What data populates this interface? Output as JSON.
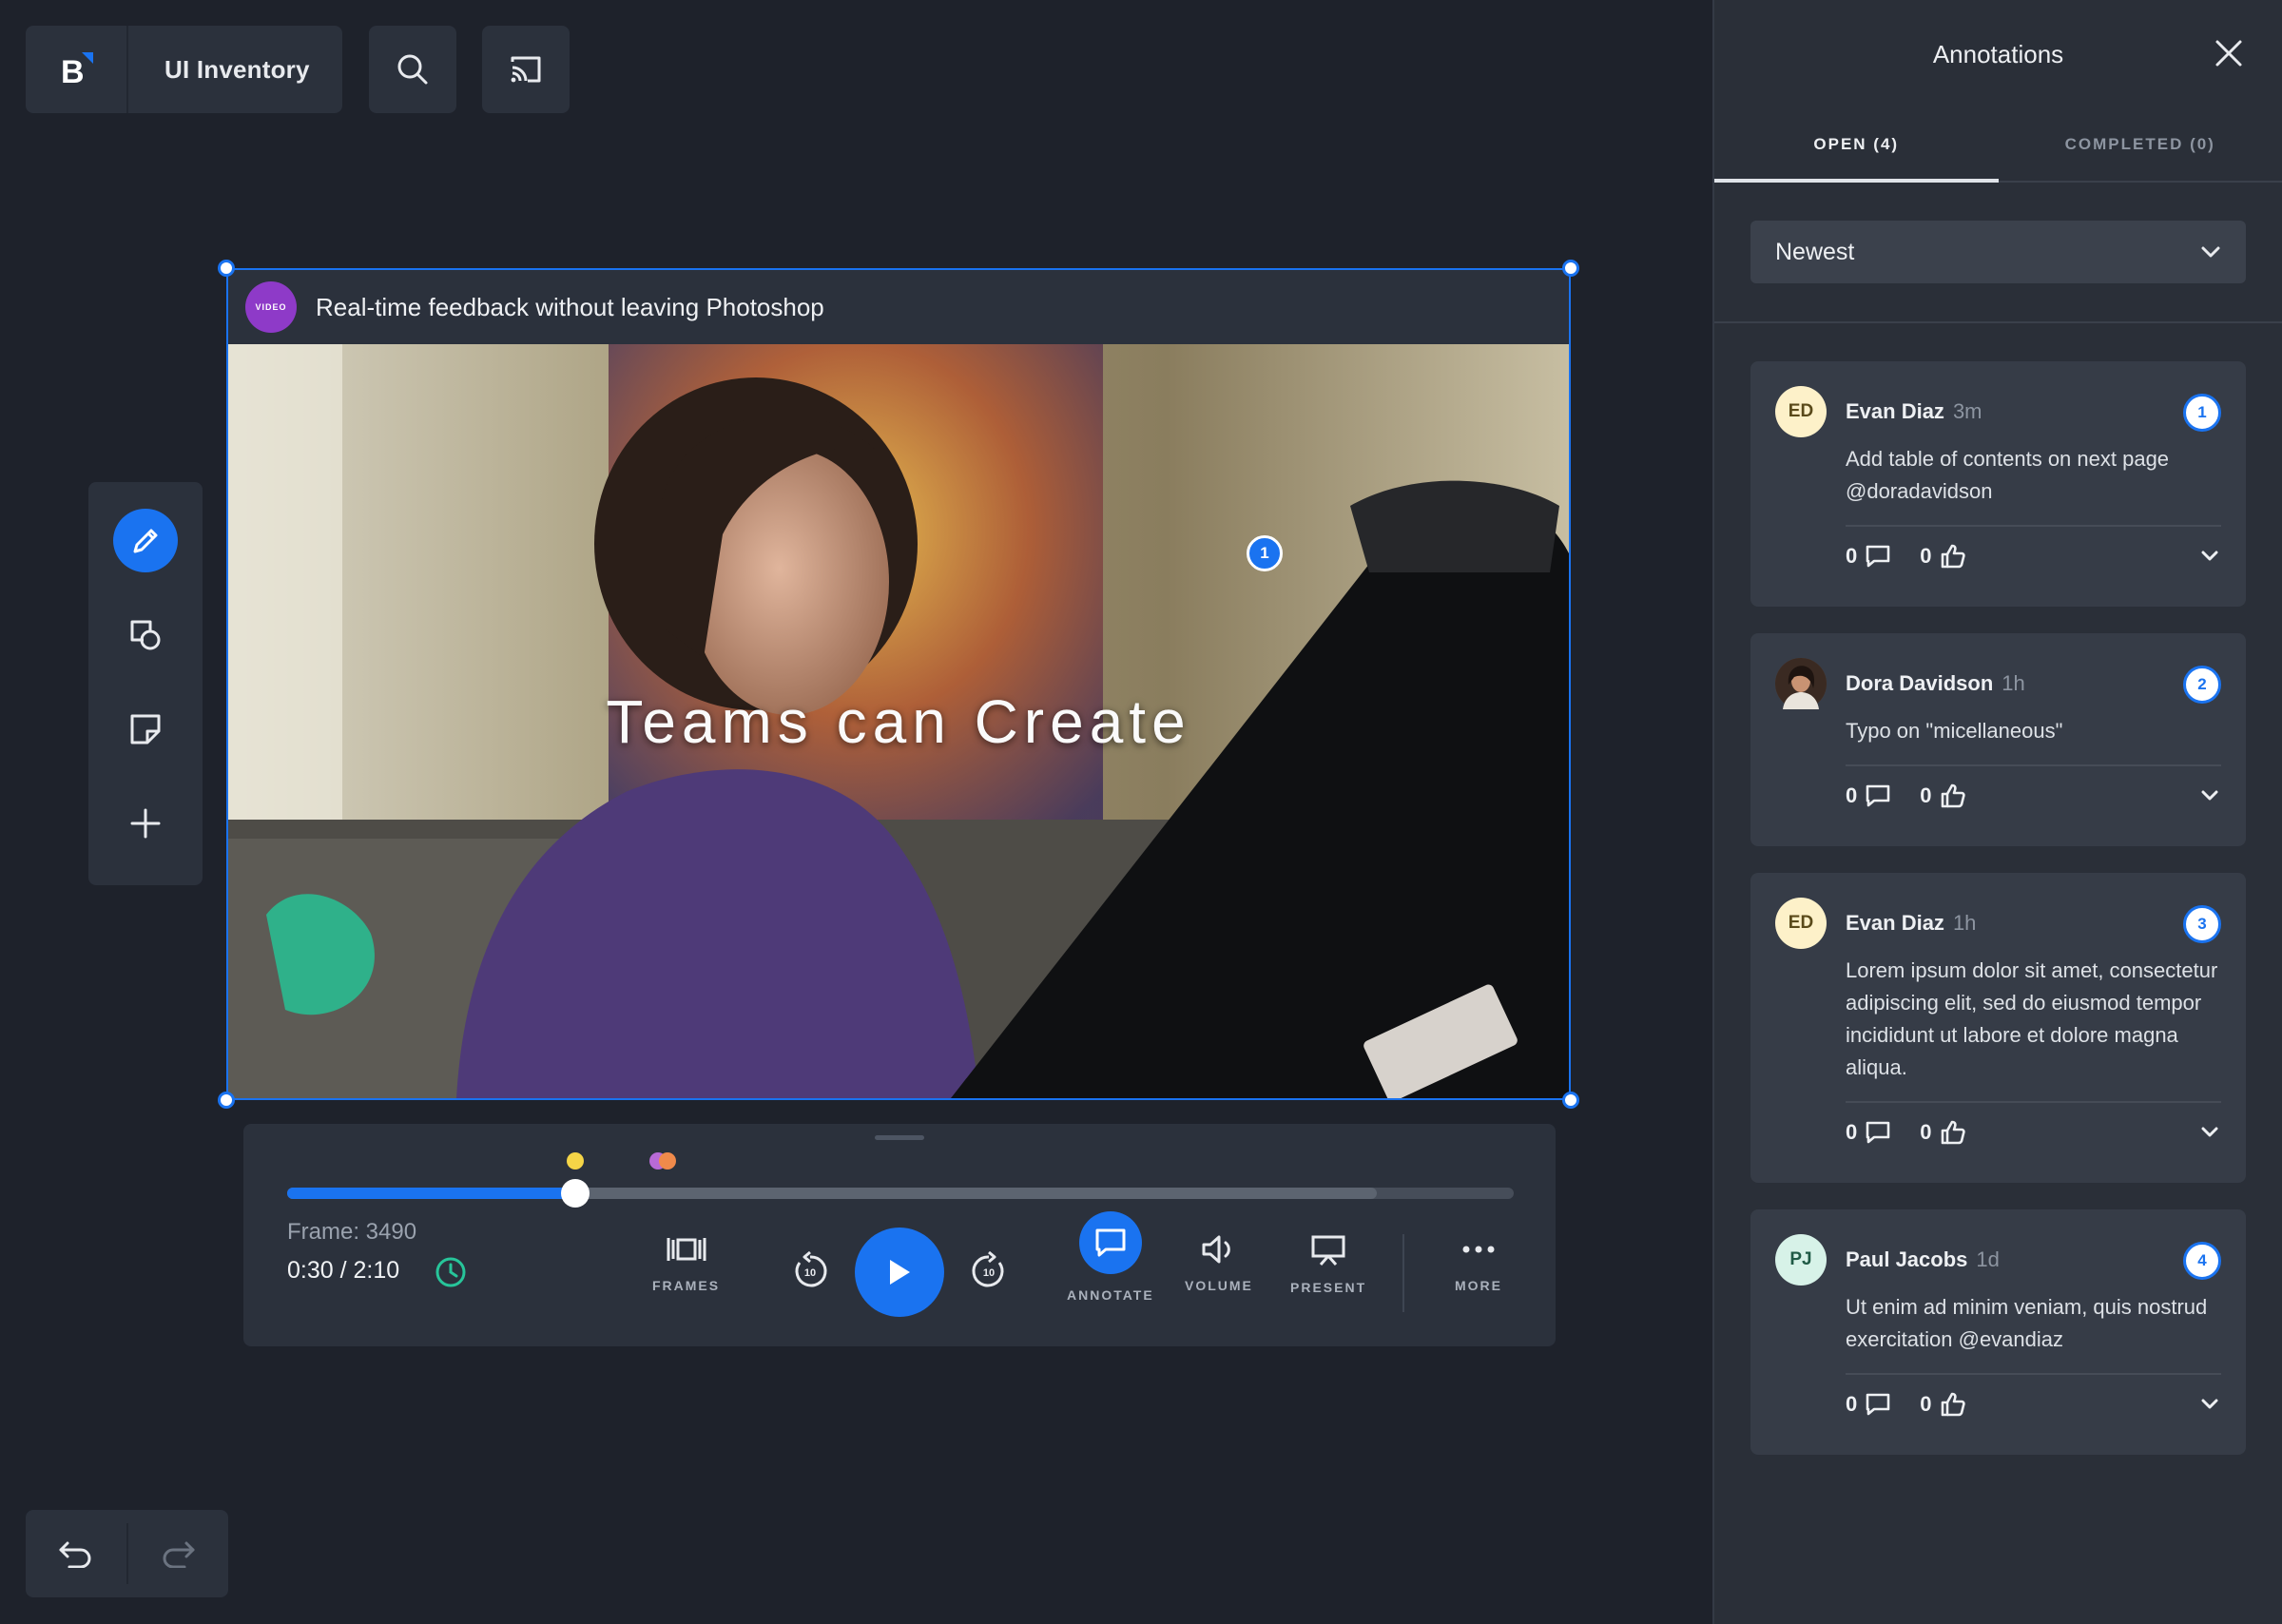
{
  "app": {
    "title": "UI Inventory",
    "logo_letter": "B"
  },
  "video": {
    "badge": "VIDEO",
    "title": "Real-time feedback without leaving Photoshop",
    "overlay_text": "Teams can Create",
    "pin_number": "1"
  },
  "player": {
    "frame_label": "Frame: 3490",
    "time_label": "0:30 / 2:10",
    "progress_fraction": 0.235,
    "buffered_fraction": 0.888,
    "markers": [
      {
        "color": "#f5d547",
        "position_fraction": 0.235
      },
      {
        "color": "#b86ad6",
        "position_fraction": 0.302
      },
      {
        "color": "#f08a4b",
        "position_fraction": 0.31
      }
    ],
    "controls": {
      "frames": "FRAMES",
      "annotate": "ANNOTATE",
      "volume": "VOLUME",
      "present": "PRESENT",
      "more": "MORE",
      "skip_seconds": "10"
    }
  },
  "panel": {
    "title": "Annotations",
    "tabs": [
      {
        "label": "OPEN (4)",
        "active": true
      },
      {
        "label": "COMPLETED (0)",
        "active": false
      }
    ],
    "sort": "Newest",
    "comments": [
      {
        "initials": "ED",
        "author": "Evan Diaz",
        "age": "3m",
        "number": "1",
        "text": "Add table of contents on next page @doradavidson",
        "replies": "0",
        "likes": "0",
        "avatar_bg": "#fdf1c9",
        "avatar_fg": "#5a4a1a"
      },
      {
        "initials": "",
        "author": "Dora Davidson",
        "age": "1h",
        "number": "2",
        "text": "Typo on \"micellaneous\"",
        "replies": "0",
        "likes": "0",
        "avatar_bg": "#6b4a3a",
        "avatar_fg": "#ffffff"
      },
      {
        "initials": "ED",
        "author": "Evan Diaz",
        "age": "1h",
        "number": "3",
        "text": "Lorem ipsum dolor sit amet, consectetur adipiscing elit, sed do eiusmod tempor incididunt ut labore et dolore magna aliqua.",
        "replies": "0",
        "likes": "0",
        "avatar_bg": "#fdf1c9",
        "avatar_fg": "#5a4a1a"
      },
      {
        "initials": "PJ",
        "author": "Paul Jacobs",
        "age": "1d",
        "number": "4",
        "text": "Ut enim ad minim veniam, quis nostrud exercitation @evandiaz",
        "replies": "0",
        "likes": "0",
        "avatar_bg": "#d7f2e8",
        "avatar_fg": "#1f5a45"
      }
    ]
  },
  "colors": {
    "accent": "#1a73f0",
    "background": "#1e222b",
    "surface": "#2b313c",
    "panel": "#2a2f38"
  }
}
